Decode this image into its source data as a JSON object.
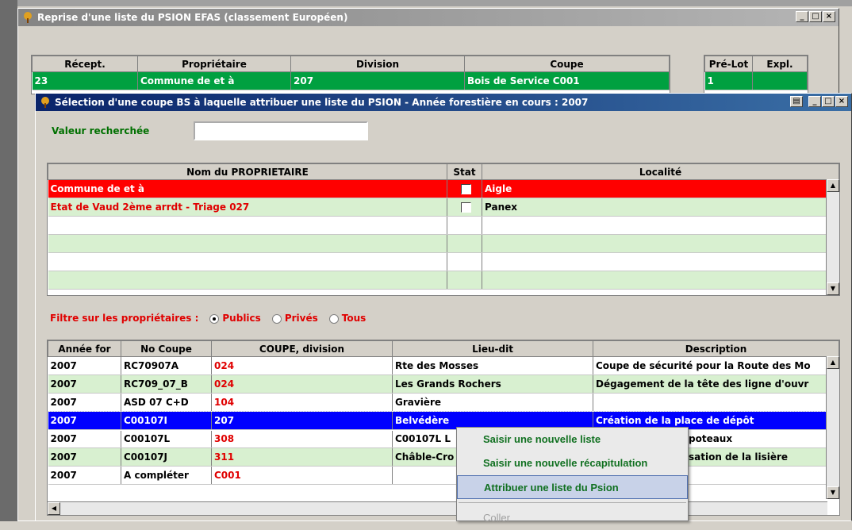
{
  "back_window": {
    "title": "Reprise d'une liste du PSION EFAS (classement Européen)",
    "columns": [
      "Récept.",
      "Propriétaire",
      "Division",
      "Coupe"
    ],
    "row": [
      "23",
      "Commune de et à",
      "207",
      "Bois de Service C001"
    ],
    "side_columns": [
      "Pré-Lot",
      "Expl."
    ],
    "side_row": [
      "1",
      ""
    ]
  },
  "dialog": {
    "title": "Sélection d'une coupe BS à laquelle attribuer une liste du PSION  -  Année forestière en cours : 2007",
    "search_label": "Valeur recherchée",
    "search_value": "",
    "owners": {
      "columns": [
        "Nom du PROPRIETAIRE",
        "Stat",
        "Localité"
      ],
      "rows": [
        {
          "name": "Commune de et à",
          "localite": "Aigle"
        },
        {
          "name": "Etat de Vaud 2ème arrdt - Triage 027",
          "localite": "Panex"
        }
      ]
    },
    "filter": {
      "label": "Filtre sur les propriétaires :",
      "options": [
        "Publics",
        "Privés",
        "Tous"
      ],
      "selected": "Publics"
    },
    "coupes": {
      "columns": [
        "Année for",
        "No Coupe",
        "COUPE, division",
        "Lieu-dit",
        "Description"
      ],
      "rows": [
        [
          "2007",
          "RC70907A",
          "024",
          "Rte des Mosses",
          "Coupe de sécurité pour la Route des Mo"
        ],
        [
          "2007",
          "RC709_07_B",
          "024",
          "Les Grands Rochers",
          "Dégagement de la tête des ligne d'ouvr"
        ],
        [
          "2007",
          "ASD 07 C+D",
          "104",
          "Gravière",
          ""
        ],
        [
          "2007",
          "C00107I",
          "207",
          "Belvédère",
          "Création de la place de dépôt"
        ],
        [
          "2007",
          "C00107L",
          "308",
          "C00107L L",
          "poteaux"
        ],
        [
          "2007",
          "C00107J",
          "311",
          "Châble-Cro",
          "sation de la lisière"
        ],
        [
          "2007",
          "A compléter",
          "C001",
          "",
          ""
        ]
      ]
    }
  },
  "context_menu": {
    "items": [
      "Saisir une nouvelle liste",
      "Saisir une nouvelle récapitulation",
      "Attribuer une liste du Psion",
      "Coller"
    ]
  },
  "colors": {
    "green_row": "#d8f0d0",
    "red_row": "#ff0000",
    "selected_row": "#0000ff",
    "header_green": "#00a040"
  }
}
